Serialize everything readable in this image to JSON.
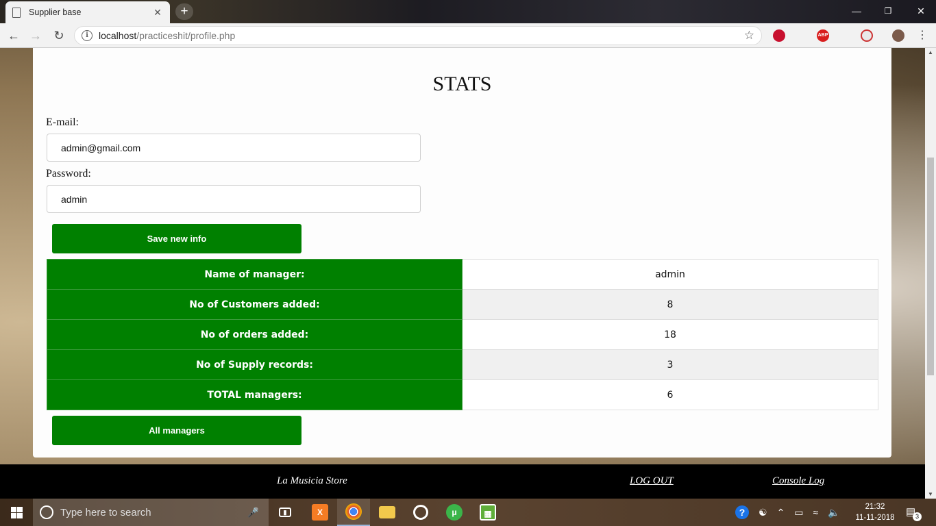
{
  "browser": {
    "tab_title": "Supplier base",
    "tab_close": "✕",
    "new_tab": "+",
    "url_host": "localhost",
    "url_path": "/practiceshit/profile.php",
    "extensions": [
      "ublock-icon",
      "adblock-plus-icon",
      "extension-icon",
      "profile-avatar"
    ],
    "adblock_label": "ABP"
  },
  "page": {
    "title": "STATS",
    "email_label": "E-mail:",
    "email_value": "admin@gmail.com",
    "password_label": "Password:",
    "password_value": "admin",
    "save_button": "Save new info",
    "all_managers_button": "All managers",
    "stats": [
      {
        "label": "Name of manager:",
        "value": "admin"
      },
      {
        "label": "No of Customers added:",
        "value": "8"
      },
      {
        "label": "No of orders added:",
        "value": "18"
      },
      {
        "label": "No of Supply records:",
        "value": "3"
      },
      {
        "label": "TOTAL managers:",
        "value": "6"
      }
    ],
    "accent_color": "#008000"
  },
  "footer": {
    "store_name": "La Musicia Store",
    "logout": "LOG OUT",
    "console_log": "Console Log"
  },
  "taskbar": {
    "search_placeholder": "Type here to search",
    "time": "21:32",
    "date": "11-11-2018",
    "notification_count": "3"
  }
}
